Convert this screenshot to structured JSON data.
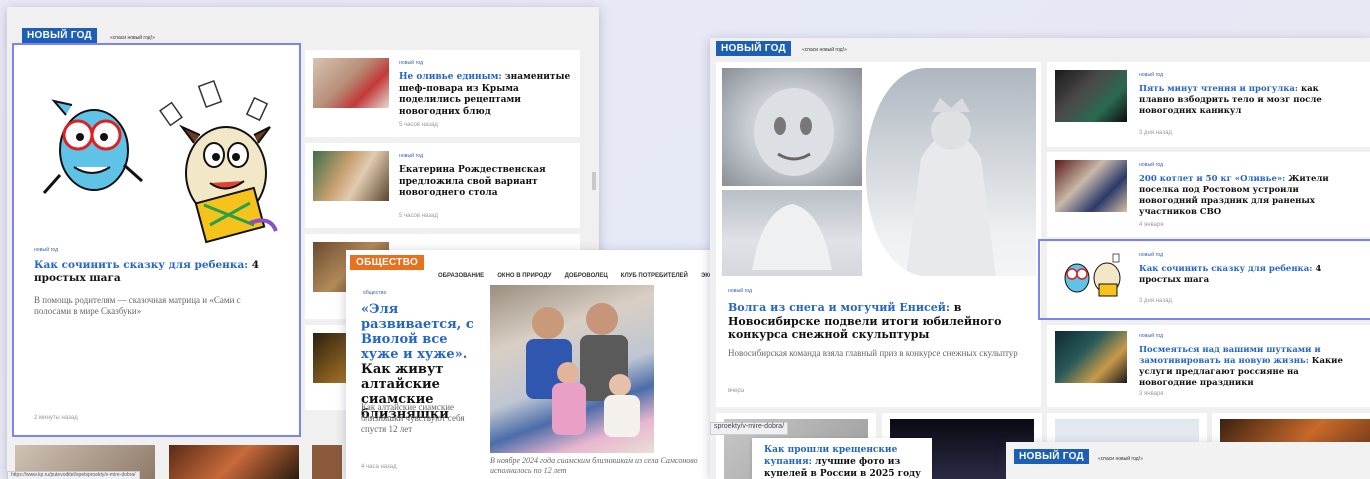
{
  "screen_a": {
    "section_badge": "НОВЫЙ ГОД",
    "section_sub": "«спаси новый год!»",
    "main_card": {
      "tag": "новый год",
      "title_link": "Как сочинить сказку для ребенка:",
      "title_rest": " 4 простых шага",
      "lead": "В помощь родителям — сказочная матрица и «Сами с полосами в мире Сказбуки»",
      "time": "2 минуты назад"
    },
    "side_items": [
      {
        "tag": "новый год",
        "title_link": "Не оливье единым:",
        "title_rest": " знаменитые шеф-повара из Крыма поделились рецептами новогодних блюд",
        "time": "5 часов назад"
      },
      {
        "tag": "новый год",
        "title_link": "",
        "title_rest": "Екатерина Рождественская предложила свой вариант новогоднего стола",
        "time": "5 часов назад"
      }
    ],
    "status_url": "https://www.kp.ru/putevoditel/spetsproekty/v-mire-dobra/"
  },
  "screen_b": {
    "section_badge": "ОБЩЕСТВО",
    "nav": [
      "Образование",
      "Окно в природу",
      "Доброволец",
      "Клуб потребителей",
      "Эколог"
    ],
    "tag": "общество",
    "title_link": "«Эля развивается, с Виолой все хуже и хуже».",
    "title_rest": " Как живут алтайские сиамские близняшки",
    "lead": "Как алтайские сиамские близняшки чувствуют себя спустя 12 лет",
    "time": "4 часа назад",
    "caption": "В ноябре 2024 года сиамским близняшкам из села Самсоново исполнилось по 12 лет"
  },
  "screen_c": {
    "section_badge": "НОВЫЙ ГОД",
    "section_sub": "«спаси новый год!»",
    "main": {
      "tag": "новый год",
      "title_link": "Волга из снега и могучий Енисей:",
      "title_rest": " в Новосибирске подвели итоги юбилейного конкурса снежной скульптуры",
      "lead": "Новосибирская команда взяла главный приз в конкурсе снежных скульптур",
      "time": "вчера"
    },
    "side_items": [
      {
        "tag": "новый год",
        "title_link": "Пять минут чтения и прогулка:",
        "title_rest": " как плавно взбодрить тело и мозг после новогодних каникул",
        "time": "3 дня назад"
      },
      {
        "tag": "новый год",
        "title_link": "200 котлет и 50 кг «Оливье»:",
        "title_rest": " Жители поселка под Ростовом устроили новогодний праздник для раненых участников СВО",
        "time": "4 января"
      },
      {
        "tag": "новый год",
        "title_link": "Как сочинить сказку для ребенка:",
        "title_rest": " 4 простых шага",
        "time": "3 дня назад"
      },
      {
        "tag": "новый год",
        "title_link": "Посмеяться над вашими шутками и замотивировать на новую жизнь:",
        "title_rest": " Какие услуги предлагают россияне на новогодние праздники",
        "time": "3 января"
      }
    ],
    "url_fragment": "sproekty/v-mire-dobra/",
    "bottom_item": {
      "title_link": "Как прошли крещенские купания:",
      "title_rest": " лучшие фото из купелей в России в 2025 году"
    }
  },
  "screen_d": {
    "section_badge": "НОВЫЙ ГОД",
    "section_sub": "«спаси новый год!»"
  },
  "colors": {
    "accent_blue": "#1d5fb4",
    "link_blue": "#2466c6",
    "orange": "#e8711f",
    "selection": "#7b84f0"
  }
}
